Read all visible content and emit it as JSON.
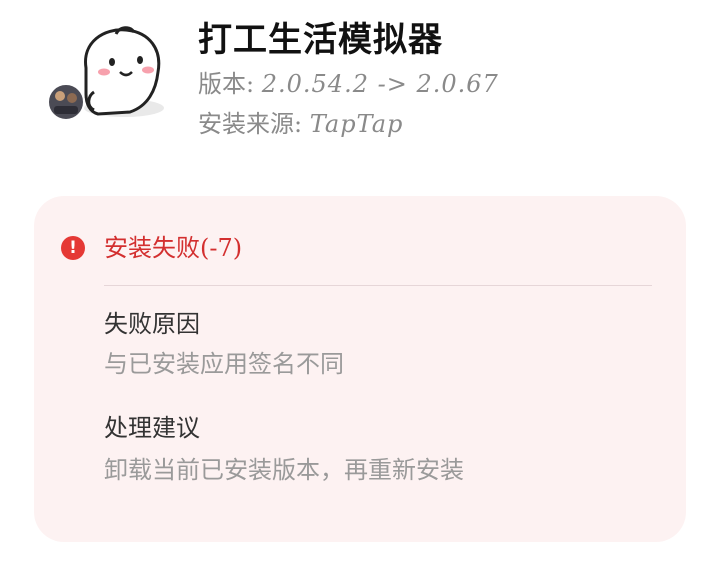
{
  "app": {
    "title": "打工生活模拟器",
    "version_label": "版本:",
    "version_value": "2.0.54.2 -> 2.0.67",
    "source_label": "安装来源:",
    "source_value": "TapTap",
    "icon": "cartoon-blob-icon"
  },
  "error": {
    "icon": "error-icon",
    "icon_glyph": "!",
    "title": "安装失败(-7)",
    "reason_heading": "失败原因",
    "reason_text": "与已安装应用签名不同",
    "advice_heading": "处理建议",
    "advice_text": "卸载当前已安装版本，再重新安装"
  },
  "colors": {
    "error_red": "#d32f2f",
    "card_bg": "#fdf2f2",
    "muted_text": "#9a9a9a"
  }
}
